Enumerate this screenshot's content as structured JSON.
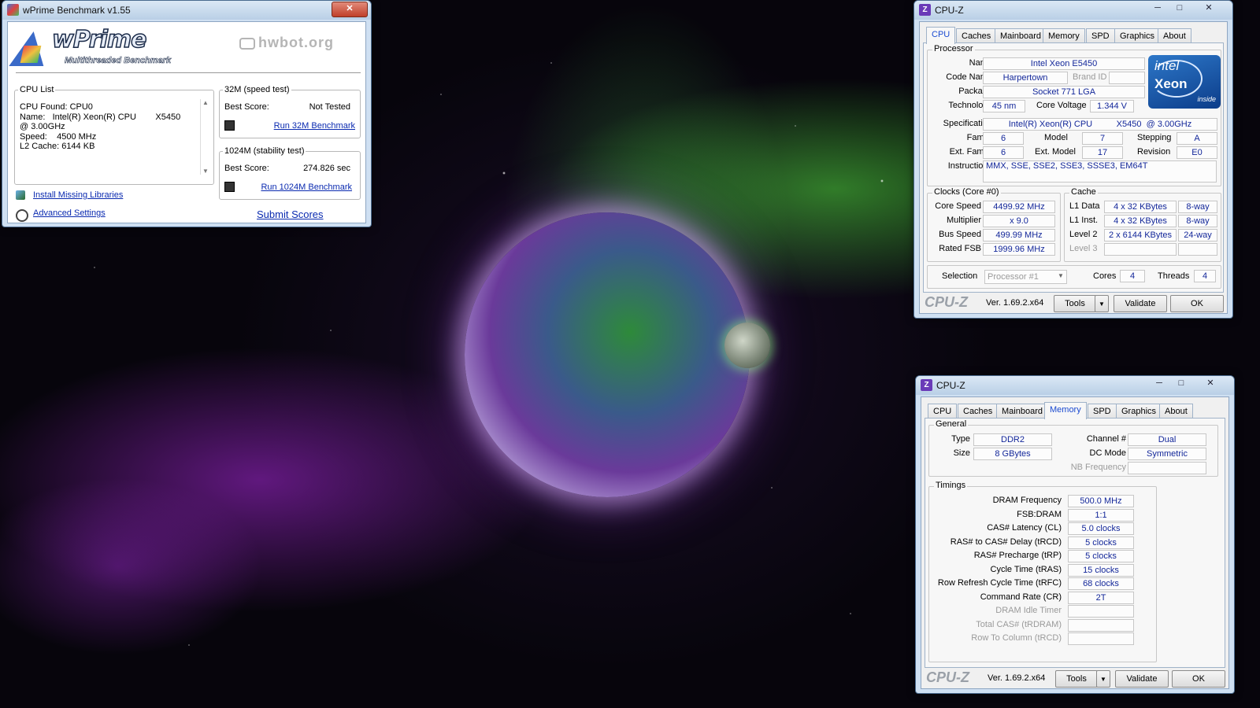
{
  "desktop": {
    "theme_colors": {
      "green_glow": "#50dc3c",
      "purple_glow": "#aa28dc"
    }
  },
  "wprime": {
    "title": "wPrime Benchmark v1.55",
    "logo_main": "wPrime",
    "logo_sub": "Multithreaded Benchmark",
    "hwbot": "hwbot.org",
    "cpu_list": {
      "legend": "CPU List",
      "lines": [
        "CPU Found: CPU0",
        "Name:   Intel(R) Xeon(R) CPU        X5450",
        "@ 3.00GHz",
        "Speed:    4500 MHz",
        "L2 Cache: 6144 KB"
      ]
    },
    "speed_test": {
      "legend": "32M (speed test)",
      "best_label": "Best Score:",
      "best_value": "Not Tested",
      "run_link": "Run 32M Benchmark"
    },
    "stability_test": {
      "legend": "1024M (stability test)",
      "best_label": "Best Score:",
      "best_value": "274.826 sec",
      "run_link": "Run 1024M Benchmark"
    },
    "install_link": "Install Missing Libraries",
    "advanced_link": "Advanced Settings",
    "submit_link": "Submit Scores"
  },
  "cpuz_cpu": {
    "title": "CPU-Z",
    "tabs": [
      "CPU",
      "Caches",
      "Mainboard",
      "Memory",
      "SPD",
      "Graphics",
      "About"
    ],
    "active_tab": "CPU",
    "processor": {
      "legend": "Processor",
      "name_label": "Name",
      "name": "Intel Xeon E5450",
      "codename_label": "Code Name",
      "codename": "Harpertown",
      "brandid_label": "Brand ID",
      "brandid": "",
      "package_label": "Package",
      "package": "Socket 771 LGA",
      "technology_label": "Technology",
      "technology": "45 nm",
      "voltage_label": "Core Voltage",
      "voltage": "1.344 V",
      "spec_label": "Specification",
      "spec": "Intel(R) Xeon(R) CPU          X5450  @ 3.00GHz",
      "family_label": "Family",
      "family": "6",
      "model_label": "Model",
      "model": "7",
      "stepping_label": "Stepping",
      "stepping": "A",
      "extfamily_label": "Ext. Family",
      "extfamily": "6",
      "extmodel_label": "Ext. Model",
      "extmodel": "17",
      "revision_label": "Revision",
      "revision": "E0",
      "instructions_label": "Instructions",
      "instructions": "MMX, SSE, SSE2, SSE3, SSSE3, EM64T"
    },
    "badge": {
      "line1": "intel",
      "line2": "Xeon",
      "line3": "inside"
    },
    "clocks": {
      "legend": "Clocks (Core #0)",
      "core_speed_label": "Core Speed",
      "core_speed": "4499.92 MHz",
      "multiplier_label": "Multiplier",
      "multiplier": "x 9.0",
      "bus_speed_label": "Bus Speed",
      "bus_speed": "499.99 MHz",
      "rated_fsb_label": "Rated FSB",
      "rated_fsb": "1999.96 MHz"
    },
    "cache": {
      "legend": "Cache",
      "l1d_label": "L1 Data",
      "l1d": "4 x 32 KBytes",
      "l1d_way": "8-way",
      "l1i_label": "L1 Inst.",
      "l1i": "4 x 32 KBytes",
      "l1i_way": "8-way",
      "l2_label": "Level 2",
      "l2": "2 x 6144 KBytes",
      "l2_way": "24-way",
      "l3_label": "Level 3",
      "l3": "",
      "l3_way": ""
    },
    "selection_label": "Selection",
    "selection": "Processor #1",
    "cores_label": "Cores",
    "cores": "4",
    "threads_label": "Threads",
    "threads": "4",
    "footer": {
      "logo": "CPU-Z",
      "version": "Ver. 1.69.2.x64",
      "tools": "Tools",
      "validate": "Validate",
      "ok": "OK"
    }
  },
  "cpuz_mem": {
    "title": "CPU-Z",
    "tabs": [
      "CPU",
      "Caches",
      "Mainboard",
      "Memory",
      "SPD",
      "Graphics",
      "About"
    ],
    "active_tab": "Memory",
    "general": {
      "legend": "General",
      "type_label": "Type",
      "type": "DDR2",
      "size_label": "Size",
      "size": "8 GBytes",
      "channel_label": "Channel #",
      "channel": "Dual",
      "dcmode_label": "DC Mode",
      "dcmode": "Symmetric",
      "nbfreq_label": "NB Frequency",
      "nbfreq": ""
    },
    "timings": {
      "legend": "Timings",
      "rows": [
        {
          "label": "DRAM Frequency",
          "value": "500.0 MHz",
          "dim": false
        },
        {
          "label": "FSB:DRAM",
          "value": "1:1",
          "dim": false
        },
        {
          "label": "CAS# Latency (CL)",
          "value": "5.0 clocks",
          "dim": false
        },
        {
          "label": "RAS# to CAS# Delay (tRCD)",
          "value": "5 clocks",
          "dim": false
        },
        {
          "label": "RAS# Precharge (tRP)",
          "value": "5 clocks",
          "dim": false
        },
        {
          "label": "Cycle Time (tRAS)",
          "value": "15 clocks",
          "dim": false
        },
        {
          "label": "Row Refresh Cycle Time (tRFC)",
          "value": "68 clocks",
          "dim": false
        },
        {
          "label": "Command Rate (CR)",
          "value": "2T",
          "dim": false
        },
        {
          "label": "DRAM Idle Timer",
          "value": "",
          "dim": true
        },
        {
          "label": "Total CAS# (tRDRAM)",
          "value": "",
          "dim": true
        },
        {
          "label": "Row To Column (tRCD)",
          "value": "",
          "dim": true
        }
      ]
    },
    "footer": {
      "logo": "CPU-Z",
      "version": "Ver. 1.69.2.x64",
      "tools": "Tools",
      "validate": "Validate",
      "ok": "OK"
    }
  }
}
